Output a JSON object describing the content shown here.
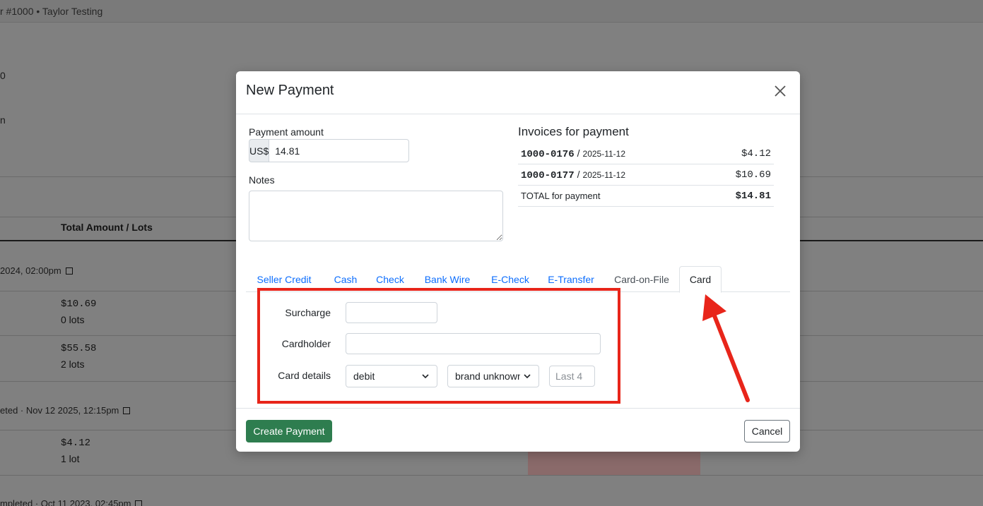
{
  "background": {
    "header_text": "r #1000 • Taylor Testing",
    "fragments": [
      "0",
      "n"
    ],
    "table_header": "Total Amount / Lots",
    "meta1": "2024, 02:00pm",
    "rows": [
      {
        "amount": "$10.69",
        "lots": "0 lots"
      },
      {
        "amount": "$55.58",
        "lots": "2 lots"
      }
    ],
    "meta2": "eted · Nov 12 2025, 12:15pm",
    "rows2": [
      {
        "amount": "$4.12",
        "lots": "1 lot"
      }
    ],
    "meta3": "mpleted · Oct 11 2023, 02:45pm"
  },
  "modal": {
    "title": "New Payment",
    "payment_amount_label": "Payment amount",
    "currency": "US$",
    "amount_value": "14.81",
    "notes_label": "Notes",
    "notes_value": "",
    "invoices_title": "Invoices for payment",
    "invoices": [
      {
        "id": "1000-0176",
        "sep": "/",
        "date": "2025-11-12",
        "amount": "$4.12"
      },
      {
        "id": "1000-0177",
        "sep": "/",
        "date": "2025-11-12",
        "amount": "$10.69"
      }
    ],
    "total_label": "TOTAL for payment",
    "total_amount": "$14.81",
    "tabs": [
      "Seller Credit",
      "Cash",
      "Check",
      "Bank Wire",
      "E-Check",
      "E-Transfer",
      "Card-on-File",
      "Card"
    ],
    "active_tab": "Card",
    "form": {
      "surcharge_label": "Surcharge",
      "surcharge_value": "",
      "cardholder_label": "Cardholder",
      "cardholder_value": "",
      "card_details_label": "Card details",
      "card_type": "debit",
      "card_brand": "brand unknown",
      "last4_placeholder": "Last 4"
    },
    "create_button": "Create Payment",
    "cancel_button": "Cancel"
  },
  "colors": {
    "link": "#0d6efd",
    "create_button": "#2e7d4f",
    "annotation": "#e8251a"
  }
}
